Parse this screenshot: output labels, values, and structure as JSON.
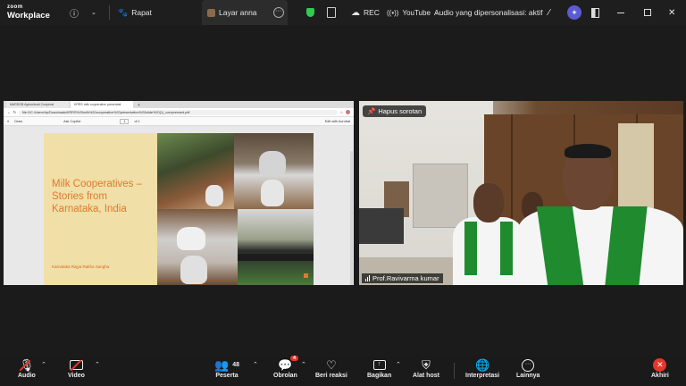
{
  "app": {
    "logo_small": "zoom",
    "logo_big": "Workplace"
  },
  "topbar": {
    "info_icon": "info-icon",
    "meeting_tab": "Rapat",
    "share_tab": "Layar anna",
    "rec_label": "REC",
    "youtube_label": "YouTube",
    "audio_mode": "Audio yang dipersonalisasi: aktif"
  },
  "shared_screen": {
    "browser_tabs": [
      "MARDOB Agricultural Cooperat",
      "KRRS milk cooperative presentati"
    ],
    "url": "file:///C:/Users/hp/Downloads/KRRS%20milk%20cooperative%20presentation%20slide%20(1)_compressed.pdf",
    "toolbar": {
      "draw": "Draw",
      "read_aloud": "Ask Copilot",
      "page_current": "1",
      "page_total": "of 1",
      "edit_acrobat": "Edit with Acrobat"
    },
    "slide": {
      "title": "Milk Cooperatives – Stories from Karnataka, India",
      "subtitle": "Karnataka Rajya Raitha Sangha"
    }
  },
  "video": {
    "remove_spotlight": "Hapus sorotan",
    "participant_name": "Prof.Ravivarma kumar"
  },
  "bottombar": {
    "audio": "Audio",
    "video": "Video",
    "participants": "Peserta",
    "participants_count": "48",
    "chat": "Obrolan",
    "chat_badge": "4",
    "reactions": "Beri reaksi",
    "share": "Bagikan",
    "host_tools": "Alat host",
    "interpretation": "Interpretasi",
    "more": "Lainnya",
    "end": "Akhiri"
  }
}
